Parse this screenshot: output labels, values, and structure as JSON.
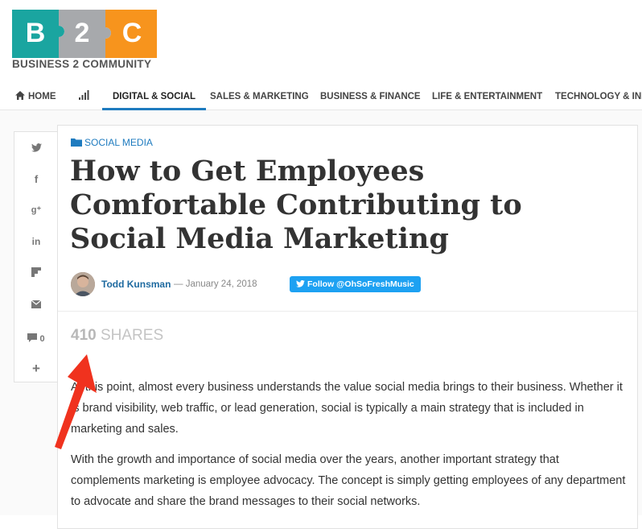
{
  "logo": {
    "letters": [
      "B",
      "2",
      "C"
    ],
    "tagline": "BUSINESS 2 COMMUNITY",
    "colors": {
      "teal": "#1aa5a0",
      "gray": "#a7a9ac",
      "orange": "#f7941d"
    }
  },
  "nav": {
    "items": [
      {
        "label": "HOME",
        "icon": "home-icon"
      },
      {
        "label": "",
        "icon": "signal-bars-icon"
      },
      {
        "label": "DIGITAL & SOCIAL",
        "active": true
      },
      {
        "label": "SALES & MARKETING"
      },
      {
        "label": "BUSINESS & FINANCE"
      },
      {
        "label": "LIFE & ENTERTAINMENT"
      },
      {
        "label": "TECHNOLOGY & INN"
      }
    ],
    "active_color": "#1e7bbf"
  },
  "share_rail": {
    "items": [
      {
        "icon": "twitter-icon"
      },
      {
        "icon": "facebook-icon"
      },
      {
        "icon": "google-plus-icon"
      },
      {
        "icon": "linkedin-icon"
      },
      {
        "icon": "flipboard-icon"
      },
      {
        "icon": "email-icon"
      },
      {
        "icon": "comment-icon",
        "count": "0"
      },
      {
        "icon": "plus-icon"
      }
    ]
  },
  "article": {
    "category": "SOCIAL MEDIA",
    "title": "How to Get Employees Comfortable Contributing to Social Media Marketing",
    "author": "Todd Kunsman",
    "date": "— January 24, 2018",
    "follow_button": "Follow @OhSoFreshMusic",
    "shares_count": "410",
    "shares_label": "SHARES",
    "paragraphs": [
      "At this point, almost every business understands the value social media brings to their business. Whether it is brand visibility, web traffic, or lead generation, social is typically a main strategy that is included in marketing and sales.",
      "With the growth and importance of social media over the years, another important strategy that complements marketing is employee advocacy. The concept is simply getting employees of any department to advocate and share the brand messages to their social networks."
    ]
  },
  "annotation": {
    "color": "#f0321e"
  }
}
